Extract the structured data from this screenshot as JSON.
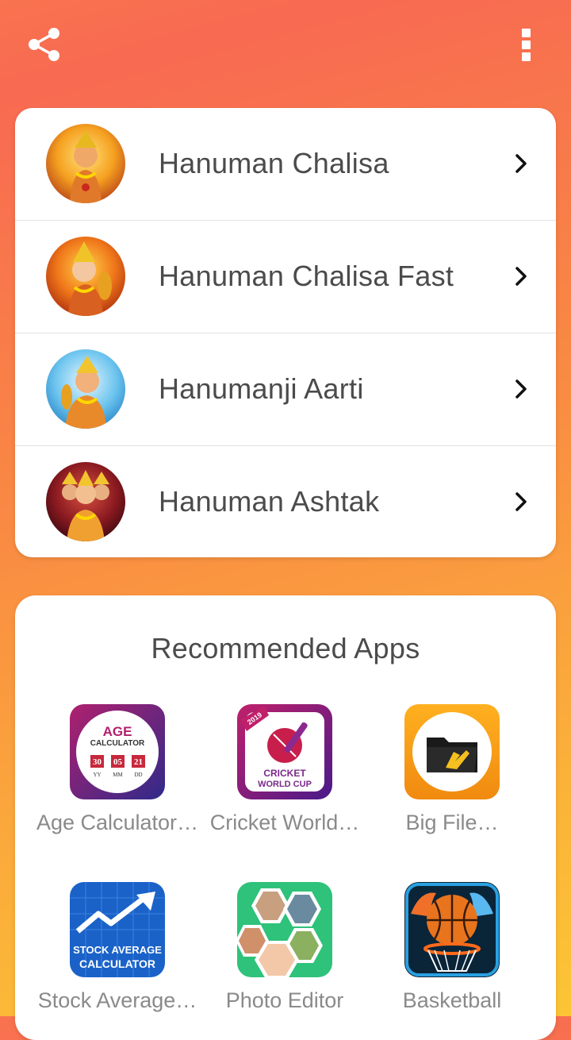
{
  "topbar": {
    "share_icon": "share-icon",
    "menu_icon": "more-vertical-icon"
  },
  "menu": {
    "items": [
      {
        "label": "Hanuman Chalisa",
        "icon": "hanuman-avatar"
      },
      {
        "label": "Hanuman Chalisa Fast",
        "icon": "hanuman-avatar"
      },
      {
        "label": "Hanumanji Aarti",
        "icon": "hanuman-avatar"
      },
      {
        "label": "Hanuman Ashtak",
        "icon": "panchmukhi-hanuman-avatar"
      }
    ]
  },
  "recommended": {
    "title": "Recommended Apps",
    "apps": [
      {
        "label": "Age Calculator…"
      },
      {
        "label": "Cricket World…"
      },
      {
        "label": "Big File…"
      },
      {
        "label": "Stock Average…"
      },
      {
        "label": "Photo Editor"
      },
      {
        "label": "Basketball"
      }
    ],
    "age_icon": {
      "title": "AGE",
      "subtitle": "CALCULATOR",
      "values": [
        "30",
        "05",
        "21"
      ],
      "units": [
        "YY",
        "MM",
        "DD"
      ]
    },
    "cricket_icon": {
      "year": "2019",
      "line1": "CRICKET",
      "line2": "WORLD CUP"
    },
    "stock_icon": {
      "line1": "STOCK AVERAGE",
      "line2": "CALCULATOR"
    }
  },
  "colors": {
    "bg_top": "#f86a52",
    "bg_bottom": "#fcc535",
    "card": "#ffffff",
    "text": "#4b4b4b",
    "muted": "#8a8a8a"
  }
}
